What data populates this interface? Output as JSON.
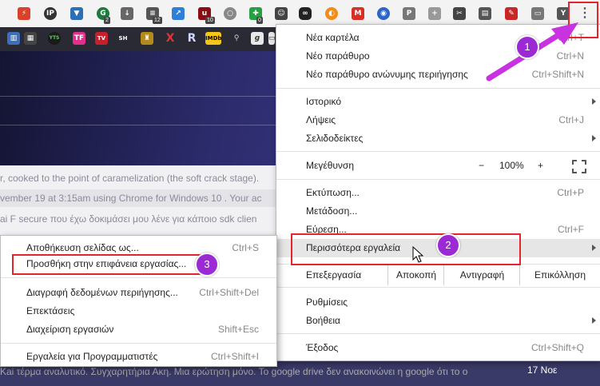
{
  "colors": {
    "accent_red": "#e3262d",
    "annotation_purple": "#9b2ad4",
    "menu_bg": "#ffffff"
  },
  "toolbar": {
    "extension_icons_row1": [
      {
        "icon": "flash-icon"
      },
      {
        "icon": "ip-icon",
        "text": "IP"
      },
      {
        "icon": "shield-icon"
      },
      {
        "icon": "grammarly-icon",
        "badge": "2"
      },
      {
        "icon": "download-icon"
      },
      {
        "icon": "news-icon",
        "badge": "12"
      },
      {
        "icon": "share-icon"
      },
      {
        "icon": "ublock-icon",
        "badge": "10"
      },
      {
        "icon": "bulb-icon"
      },
      {
        "icon": "puzzle-icon",
        "badge": "0"
      },
      {
        "icon": "face-icon"
      },
      {
        "icon": "tape-icon"
      },
      {
        "icon": "firefox-icon"
      },
      {
        "icon": "gmail-icon"
      },
      {
        "icon": "camera-icon"
      },
      {
        "icon": "pdf-icon"
      },
      {
        "icon": "plus-icon"
      },
      {
        "icon": "scissors-icon"
      },
      {
        "icon": "clipboard-icon"
      },
      {
        "icon": "pin-icon"
      },
      {
        "icon": "paste-icon"
      },
      {
        "icon": "y-icon"
      }
    ],
    "extension_icons_row2": [
      {
        "icon": "book-icon"
      },
      {
        "icon": "grid-icon"
      },
      {
        "icon": "yts-icon",
        "text": "YTS"
      },
      {
        "icon": "tf-icon",
        "text": "TF"
      },
      {
        "icon": "tv-icon",
        "text": "TV"
      },
      {
        "icon": "sh-icon",
        "text": "SH"
      },
      {
        "icon": "bookmark-icon"
      },
      {
        "icon": "x-icon",
        "text": "X"
      },
      {
        "icon": "r-icon",
        "text": "R"
      },
      {
        "icon": "imdb-icon",
        "text": "IMDb"
      },
      {
        "icon": "magnifier-icon"
      },
      {
        "icon": "g-icon",
        "text": "g"
      },
      {
        "icon": "terminal-icon"
      }
    ],
    "menu_button_icon": "three-dots-vertical-icon"
  },
  "background_page": {
    "rows": [
      "r, cooked to the point of caramelization (the soft crack stage).",
      "vember 19 at 3:15am using Chrome for Windows 10 . Your ac",
      "ai F secure που έχω δοκιμάσει μου λένε για κάποιο sdk clien"
    ],
    "bottom_text": "Kai τέρμα αναλυτικό. Συγχαρητήρια Ακη. Μια ερώτηση μόνο. Το google drive δεν ανακοινώνει η google ότι το ο",
    "bottom_date": "17 Νοε"
  },
  "main_menu": {
    "new_tab": {
      "label": "Νέα καρτέλα",
      "shortcut": "Ctrl+T"
    },
    "new_window": {
      "label": "Νέο παράθυρο",
      "shortcut": "Ctrl+N"
    },
    "new_incognito": {
      "label": "Νέο παράθυρο ανώνυμης περιήγησης",
      "shortcut": "Ctrl+Shift+N"
    },
    "history": {
      "label": "Ιστορικό"
    },
    "downloads": {
      "label": "Λήψεις",
      "shortcut": "Ctrl+J"
    },
    "bookmarks": {
      "label": "Σελιδοδείκτες"
    },
    "zoom": {
      "label": "Μεγέθυνση",
      "minus": "−",
      "value": "100%",
      "plus": "+"
    },
    "print": {
      "label": "Εκτύπωση...",
      "shortcut": "Ctrl+P"
    },
    "cast": {
      "label": "Μετάδοση..."
    },
    "find": {
      "label": "Εύρεση...",
      "shortcut": "Ctrl+F"
    },
    "more_tools": {
      "label": "Περισσότερα εργαλεία"
    },
    "edit": {
      "label": "Επεξεργασία",
      "cut": "Αποκοπή",
      "copy": "Αντιγραφή",
      "paste": "Επικόλληση"
    },
    "settings": {
      "label": "Ρυθμίσεις"
    },
    "help": {
      "label": "Βοήθεια"
    },
    "exit": {
      "label": "Έξοδος",
      "shortcut": "Ctrl+Shift+Q"
    }
  },
  "sub_menu": {
    "save_page": {
      "label": "Αποθήκευση σελίδας ως...",
      "shortcut": "Ctrl+S"
    },
    "add_to_desktop": {
      "label": "Προσθήκη στην επιφάνεια εργασίας..."
    },
    "clear_data": {
      "label": "Διαγραφή δεδομένων περιήγησης...",
      "shortcut": "Ctrl+Shift+Del"
    },
    "extensions": {
      "label": "Επεκτάσεις"
    },
    "task_manager": {
      "label": "Διαχείριση εργασιών",
      "shortcut": "Shift+Esc"
    },
    "dev_tools": {
      "label": "Εργαλεία για Προγραμματιστές",
      "shortcut": "Ctrl+Shift+I"
    }
  },
  "annotations": {
    "step1": "1",
    "step2": "2",
    "step3": "3"
  }
}
